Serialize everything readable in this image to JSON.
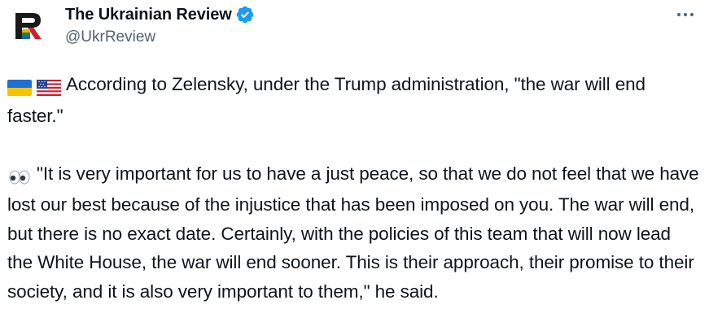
{
  "author": {
    "display_name": "The Ukrainian Review",
    "handle": "@UkrReview",
    "avatar_letter": "R",
    "verified": true
  },
  "colors": {
    "text": "#0f1419",
    "secondary": "#536471",
    "verified_blue": "#1d9bf0"
  },
  "tweet": {
    "paragraph1_emojis": [
      "ukraine-flag",
      "us-flag"
    ],
    "paragraph1": "According to Zelensky, under the Trump administration, \"the war will end faster.\"",
    "paragraph2_emojis": [
      "eyes"
    ],
    "paragraph2": "\"It is very important for us to have a just peace, so that we do not feel that we have lost our best because of the injustice that has been imposed on you. The war will end, but there is no exact date. Certainly, with the policies of this team that will now lead the White House, the war will end sooner. This is their approach, their promise to their society, and it is also very important to them,\" he said."
  }
}
